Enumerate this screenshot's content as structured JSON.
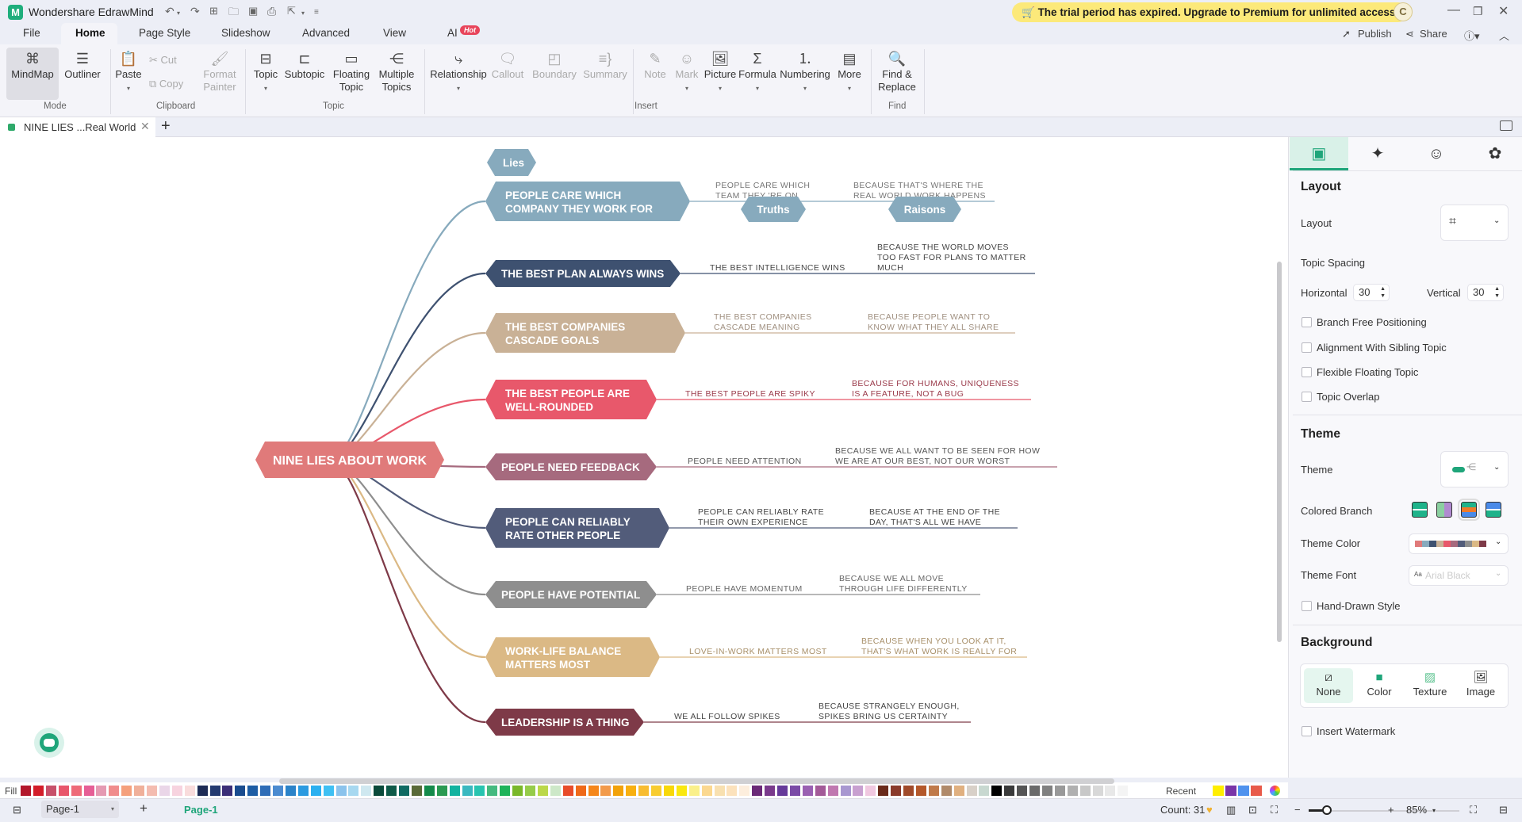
{
  "app": {
    "title": "Wondershare EdrawMind",
    "trial_banner": "The trial period has expired. Upgrade to Premium for unlimited access.",
    "avatar_letter": "C"
  },
  "menu": {
    "tabs": [
      "File",
      "Home",
      "Page Style",
      "Slideshow",
      "Advanced",
      "View",
      "AI"
    ],
    "active": "Home",
    "ai_badge": "Hot",
    "publish": "Publish",
    "share": "Share"
  },
  "ribbon": {
    "mode": {
      "label": "Mode",
      "mindmap": "MindMap",
      "outliner": "Outliner"
    },
    "clipboard": {
      "label": "Clipboard",
      "paste": "Paste",
      "cut": "Cut",
      "copy": "Copy",
      "format_painter_1": "Format",
      "format_painter_2": "Painter"
    },
    "topic": {
      "label": "Topic",
      "topic": "Topic",
      "subtopic": "Subtopic",
      "floating_1": "Floating",
      "floating_2": "Topic",
      "multiple_1": "Multiple",
      "multiple_2": "Topics"
    },
    "insert": {
      "label": "Insert",
      "relationship": "Relationship",
      "callout": "Callout",
      "boundary": "Boundary",
      "summary": "Summary",
      "note": "Note",
      "mark": "Mark",
      "picture": "Picture",
      "formula": "Formula",
      "numbering": "Numbering",
      "more": "More"
    },
    "find": {
      "label": "Find",
      "find_replace_1": "Find &",
      "find_replace_2": "Replace"
    }
  },
  "document_tab": {
    "title": "NINE LIES ...Real World"
  },
  "mindmap": {
    "central": {
      "text": "NINE LIES ABOUT WORK",
      "color": "#e07a7a"
    },
    "header_labels": {
      "lies": "Lies",
      "truths": "Truths",
      "raisons": "Raisons",
      "color": "#87aabd"
    },
    "branches": [
      {
        "lines": [
          "PEOPLE CARE WHICH",
          "COMPANY THEY WORK FOR"
        ],
        "color": "#87aabd",
        "truth": [
          "PEOPLE CARE WHICH",
          "TEAM THEY 'RE ON"
        ],
        "reason": [
          "BECAUSE THAT'S WHERE THE",
          "REAL WORLD WORK HAPPENS"
        ],
        "text_color": "#777777"
      },
      {
        "lines": [
          "THE BEST PLAN ALWAYS WINS"
        ],
        "color": "#3e5170",
        "truth": [
          "THE BEST INTELLIGENCE WINS"
        ],
        "reason": [
          "BECAUSE THE WORLD MOVES",
          "TOO FAST FOR PLANS TO MATTER",
          "MUCH"
        ],
        "text_color": "#444444"
      },
      {
        "lines": [
          "THE BEST COMPANIES",
          "CASCADE GOALS"
        ],
        "color": "#c9b196",
        "truth": [
          "THE BEST COMPANIES",
          "CASCADE MEANING"
        ],
        "reason": [
          "BECAUSE PEOPLE WANT TO",
          "KNOW WHAT THEY ALL SHARE"
        ],
        "text_color": "#a09080"
      },
      {
        "lines": [
          "THE BEST PEOPLE ARE",
          "WELL-ROUNDED"
        ],
        "color": "#e8586b",
        "truth": [
          "THE BEST PEOPLE ARE SPIKY"
        ],
        "reason": [
          "BECAUSE FOR HUMANS, UNIQUENESS",
          "IS A FEATURE, NOT A BUG"
        ],
        "text_color": "#9a3a4a"
      },
      {
        "lines": [
          "PEOPLE NEED FEEDBACK"
        ],
        "color": "#a66a7e",
        "truth": [
          "PEOPLE NEED ATTENTION"
        ],
        "reason": [
          "BECAUSE WE ALL WANT TO BE SEEN FOR HOW",
          "WE ARE AT OUR BEST, NOT OUR WORST"
        ],
        "text_color": "#555555"
      },
      {
        "lines": [
          "PEOPLE CAN RELIABLY",
          "RATE OTHER PEOPLE"
        ],
        "color": "#525c7a",
        "truth": [
          "PEOPLE CAN RELIABLY RATE",
          "THEIR OWN EXPERIENCE"
        ],
        "reason": [
          "BECAUSE AT THE END OF THE",
          "DAY, THAT'S ALL WE HAVE"
        ],
        "text_color": "#444444"
      },
      {
        "lines": [
          "PEOPLE HAVE POTENTIAL"
        ],
        "color": "#8e8e8e",
        "truth": [
          "PEOPLE HAVE MOMENTUM"
        ],
        "reason": [
          "BECAUSE WE ALL MOVE",
          "THROUGH LIFE DIFFERENTLY"
        ],
        "text_color": "#666666"
      },
      {
        "lines": [
          "WORK-LIFE BALANCE",
          "MATTERS MOST"
        ],
        "color": "#dbb985",
        "truth": [
          "LOVE-IN-WORK MATTERS MOST"
        ],
        "reason": [
          "BECAUSE WHEN YOU LOOK AT IT,",
          "THAT'S WHAT WORK IS REALLY FOR"
        ],
        "text_color": "#a8906a"
      },
      {
        "lines": [
          "LEADERSHIP IS A THING"
        ],
        "color": "#7e3a48",
        "truth": [
          "WE ALL FOLLOW SPIKES"
        ],
        "reason": [
          "BECAUSE STRANGELY ENOUGH,",
          "SPIKES BRING US CERTAINTY"
        ],
        "text_color": "#444444"
      }
    ]
  },
  "right_panel": {
    "layout_section": "Layout",
    "layout_label": "Layout",
    "topic_spacing": "Topic Spacing",
    "horizontal_label": "Horizontal",
    "horizontal_value": "30",
    "vertical_label": "Vertical",
    "vertical_value": "30",
    "checkboxes": [
      {
        "label": "Branch Free Positioning",
        "checked": false
      },
      {
        "label": "Alignment With Sibling Topic",
        "checked": false
      },
      {
        "label": "Flexible Floating Topic",
        "checked": false
      },
      {
        "label": "Topic Overlap",
        "checked": false
      }
    ],
    "theme_section": "Theme",
    "theme_label": "Theme",
    "colored_branch_label": "Colored Branch",
    "theme_color_label": "Theme Color",
    "theme_colors": [
      "#e07a7a",
      "#87aabd",
      "#3e5170",
      "#c9b196",
      "#e8586b",
      "#a66a7e",
      "#525c7a",
      "#8e8e8e",
      "#dbb985",
      "#7e3a48"
    ],
    "theme_font_label": "Theme Font",
    "theme_font_value": "Arial Black",
    "hand_drawn": "Hand-Drawn Style",
    "background_section": "Background",
    "background_options": [
      "None",
      "Color",
      "Texture",
      "Image"
    ],
    "background_selected": "None",
    "watermark": "Insert Watermark"
  },
  "palette": {
    "fill_label": "Fill",
    "recent_label": "Recent",
    "recent_colors": [
      "#ffee00",
      "#7a35a8",
      "#4f92ee",
      "#e85a4a"
    ],
    "colors": [
      "#b3172b",
      "#d31d2a",
      "#c7506a",
      "#e8566b",
      "#ee6a78",
      "#e65f96",
      "#e59ab2",
      "#f08c8c",
      "#f5a07c",
      "#f0b09a",
      "#f4bcb0",
      "#ead6e8",
      "#f7d3df",
      "#f9dcdc",
      "#1d2b55",
      "#243a70",
      "#3c2f78",
      "#1a4c8f",
      "#1e5da4",
      "#2f6db7",
      "#4b8bd0",
      "#2b83c9",
      "#2b9ae0",
      "#2bb0f0",
      "#3fc0f3",
      "#8bc3ec",
      "#a7d8f0",
      "#cfe8f0",
      "#0a4a3a",
      "#0e5a48",
      "#0f6a62",
      "#5a6a38",
      "#148a4a",
      "#2a9a52",
      "#13b3a0",
      "#3ab8c0",
      "#28c4b0",
      "#45ba80",
      "#1fb35a",
      "#7ab82a",
      "#96cc4a",
      "#bbd84a",
      "#cde8c8",
      "#e84c2a",
      "#ef6a1a",
      "#f5861a",
      "#f29a4a",
      "#f2a20a",
      "#f8b010",
      "#f8bc30",
      "#f8cc30",
      "#f8d808",
      "#fae810",
      "#faf08a",
      "#fbd890",
      "#f8e0b0",
      "#fce2bc",
      "#fdeedd",
      "#6b2a78",
      "#7a3a8c",
      "#663a9a",
      "#7a4aa6",
      "#9a60b2",
      "#a35a98",
      "#c078b0",
      "#a897d0",
      "#c8a0d0",
      "#f0c8e0",
      "#6a2a1a",
      "#8a3a2a",
      "#a04a2a",
      "#b4582a",
      "#c07a4a",
      "#b08a6a",
      "#e0b080",
      "#d8d0c8",
      "#c8d8d0",
      "#000000",
      "#3a3a3a",
      "#555555",
      "#6a6a6a",
      "#808080",
      "#999999",
      "#b0b0b0",
      "#c8c8c8",
      "#d8d8d8",
      "#e8e8e8",
      "#f4f4f4"
    ]
  },
  "status": {
    "page_select": "Page-1",
    "page_tab": "Page-1",
    "count": "Count: 31",
    "zoom": "85%",
    "zoom_fraction": 0.12
  }
}
